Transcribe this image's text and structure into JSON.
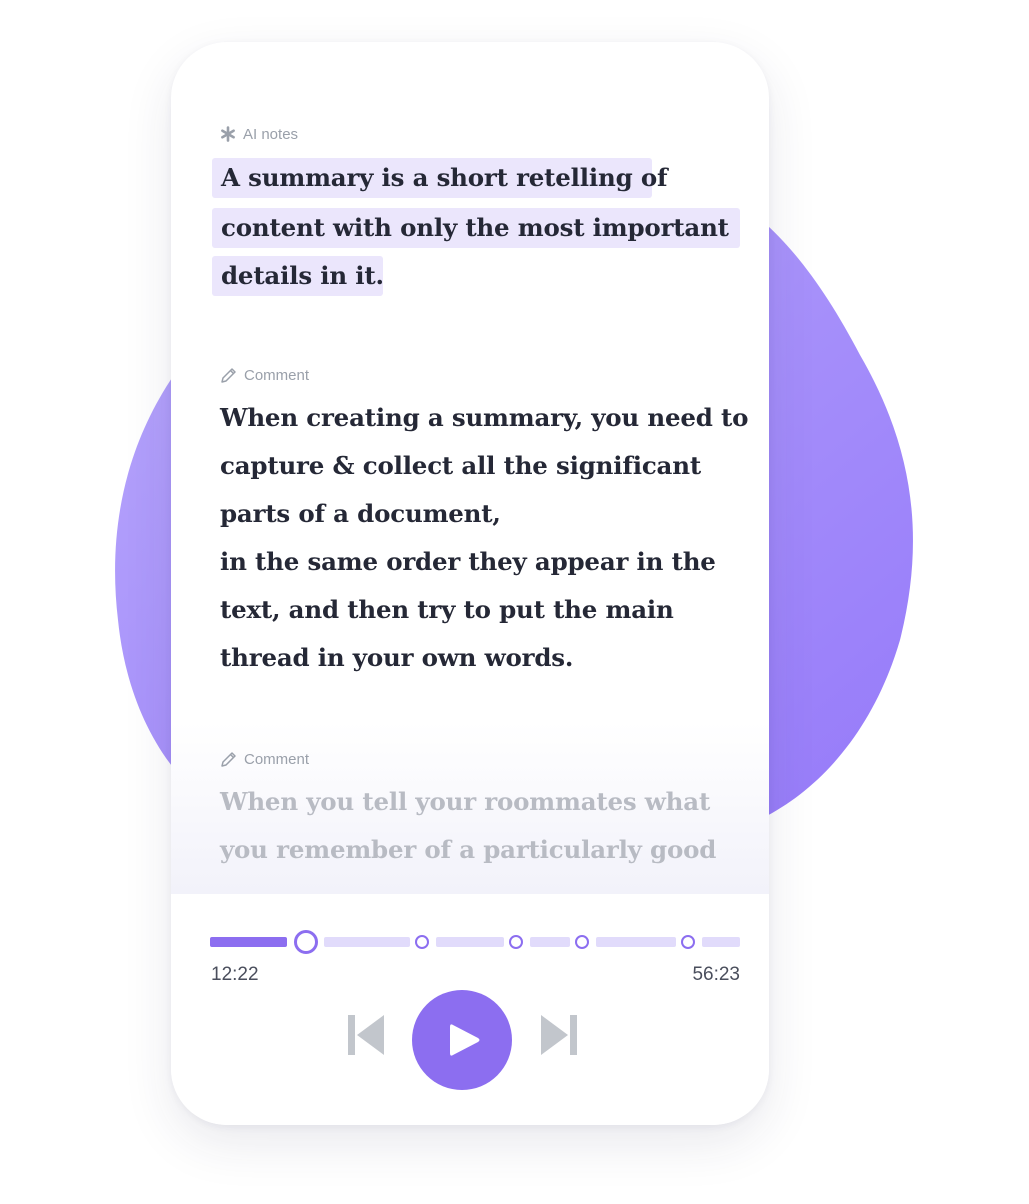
{
  "colors": {
    "accent": "#8c6ef0",
    "highlight": "#ebe6fc",
    "blob": "#a48bfb",
    "text": "#252836",
    "muted": "#9aa0aa",
    "faded_text": "#b8bbc3",
    "control_gray": "#c2c6cc"
  },
  "ai_notes": {
    "label": "AI notes",
    "icon": "asterisk-icon",
    "lines": [
      "A summary is a short retelling of",
      "content with only the most important",
      "details in it."
    ]
  },
  "comments": [
    {
      "label": "Comment",
      "icon": "pencil-icon",
      "lines": [
        "When creating a summary, you need to",
        "capture & collect all the significant",
        "parts of a document,",
        "in the same order they appear in the",
        "text, and then try to put the main",
        "thread in your own words."
      ]
    },
    {
      "label": "Comment",
      "icon": "pencil-icon",
      "lines": [
        "When you tell your roommates what",
        "you remember of a particularly good"
      ]
    }
  ],
  "player": {
    "current_time": "12:22",
    "total_time": "56:23",
    "progress": 0.219,
    "chapter_markers": 4,
    "controls": {
      "previous": "skip-previous-icon",
      "play": "play-icon",
      "next": "skip-next-icon"
    }
  }
}
